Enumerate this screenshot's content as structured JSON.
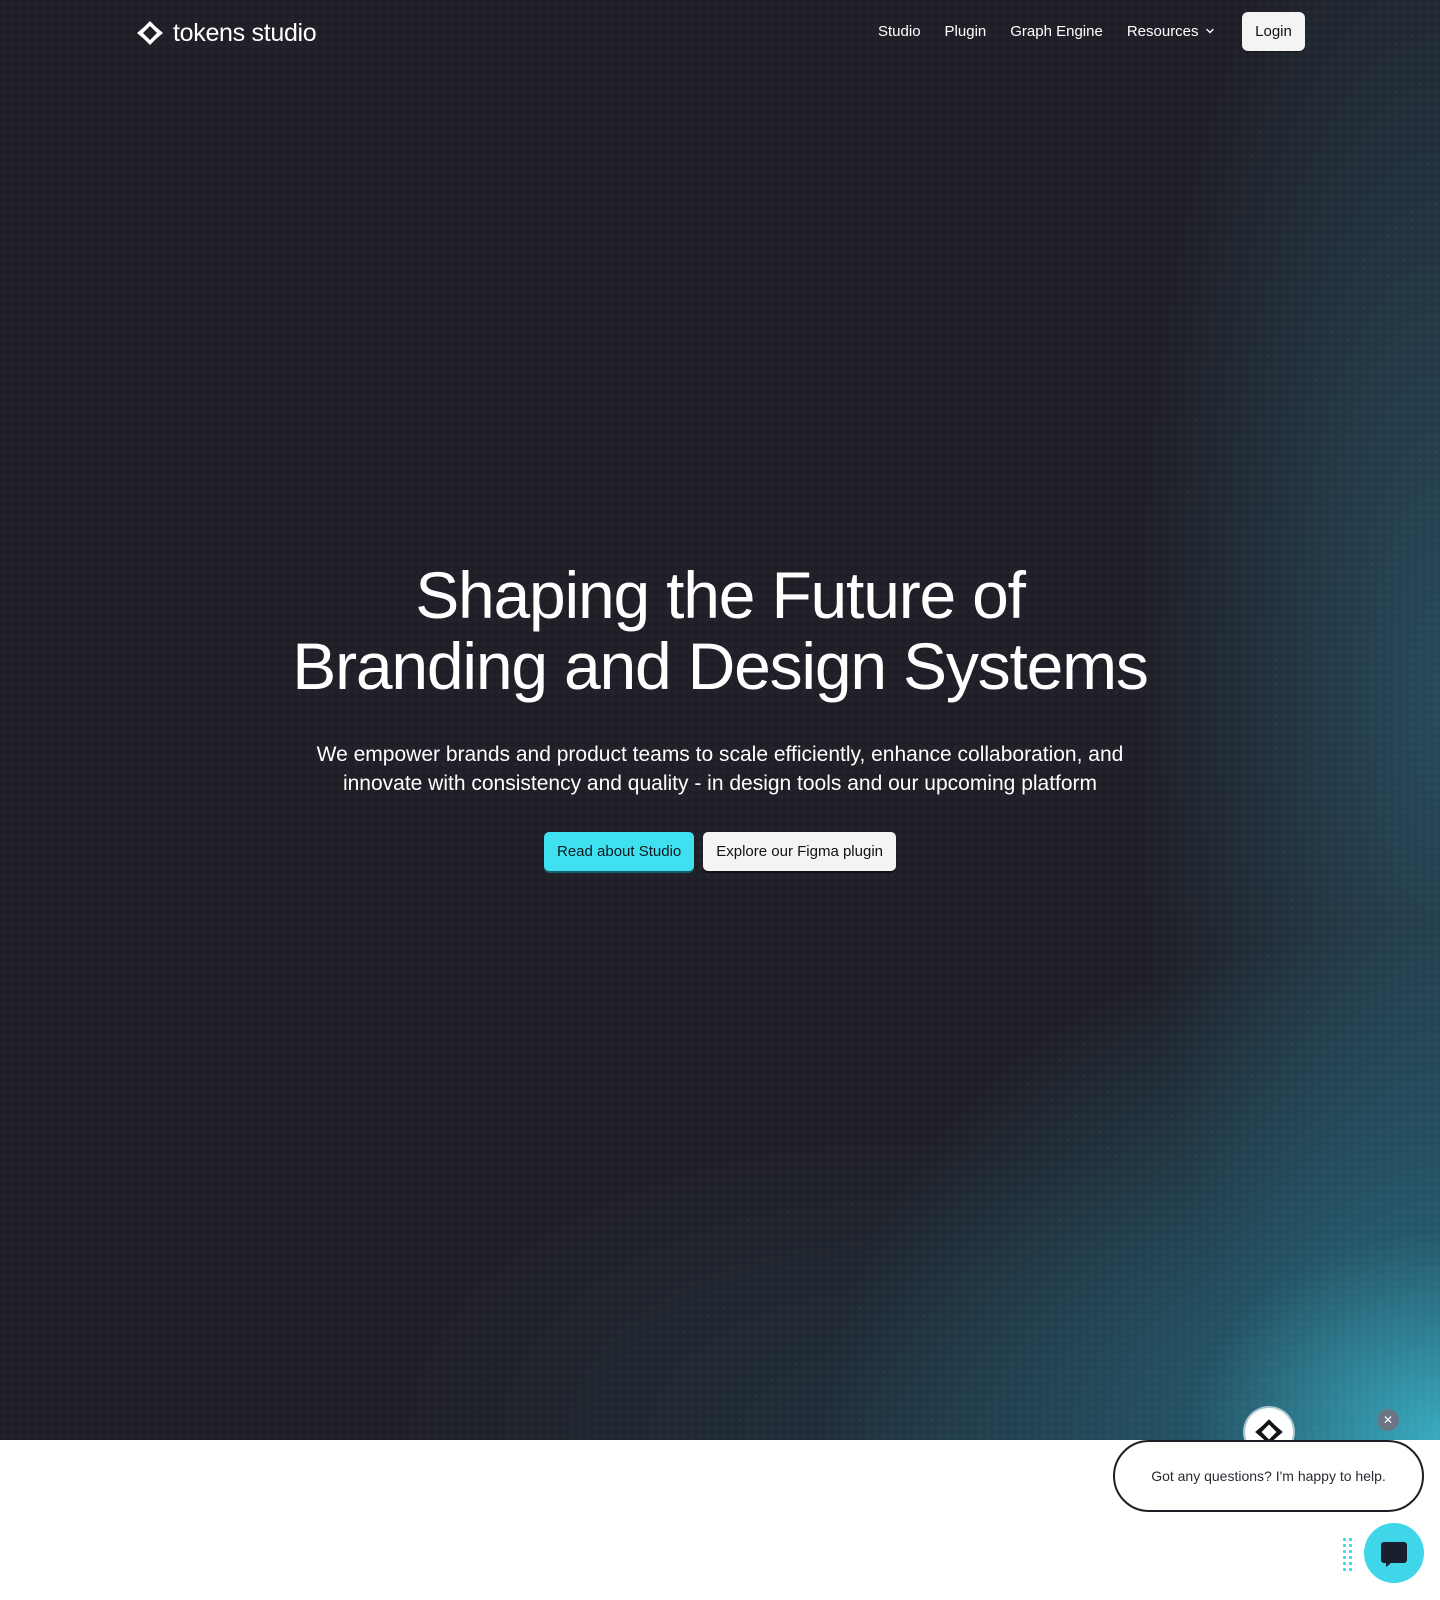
{
  "nav": {
    "brand_name": "tokens studio",
    "links": [
      {
        "label": "Studio"
      },
      {
        "label": "Plugin"
      },
      {
        "label": "Graph Engine"
      },
      {
        "label": "Resources"
      }
    ],
    "login_label": "Login"
  },
  "hero": {
    "headline_line1": "Shaping the Future of",
    "headline_line2": "Branding and Design Systems",
    "subhead_line1": "We empower brands and product teams to scale efficiently, enhance collaboration, and",
    "subhead_line2": "innovate with consistency and quality - in design tools and our upcoming platform",
    "primary_cta": "Read about Studio",
    "secondary_cta": "Explore our Figma plugin"
  },
  "chat": {
    "close_glyph": "✕",
    "message": "Got any questions? I'm happy to help."
  },
  "icons": {
    "logo": "tokens-studio-logo-icon",
    "chevron": "chevron-down-icon",
    "chat_avatar": "tokens-studio-logo-icon",
    "chat_launcher": "chat-bubble-icon",
    "close": "close-icon"
  },
  "colors": {
    "background": "#1f1f27",
    "accent": "#3fe0f0",
    "button_light": "#f4f4f5"
  }
}
